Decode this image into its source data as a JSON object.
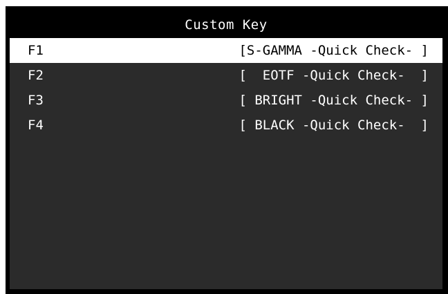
{
  "menu": {
    "title": "Custom Key",
    "items": [
      {
        "key": "F1",
        "value": "[S-GAMMA -Quick Check- ]",
        "selected": true
      },
      {
        "key": "F2",
        "value": "[  EOTF -Quick Check-  ]",
        "selected": false
      },
      {
        "key": "F3",
        "value": "[ BRIGHT -Quick Check- ]",
        "selected": false
      },
      {
        "key": "F4",
        "value": "[ BLACK -Quick Check-  ]",
        "selected": false
      }
    ]
  },
  "colors": {
    "header_bg": "#000000",
    "body_bg": "#2b2b2b",
    "selected_bg": "#ffffff",
    "text": "#ffffff",
    "selected_text": "#000000"
  }
}
